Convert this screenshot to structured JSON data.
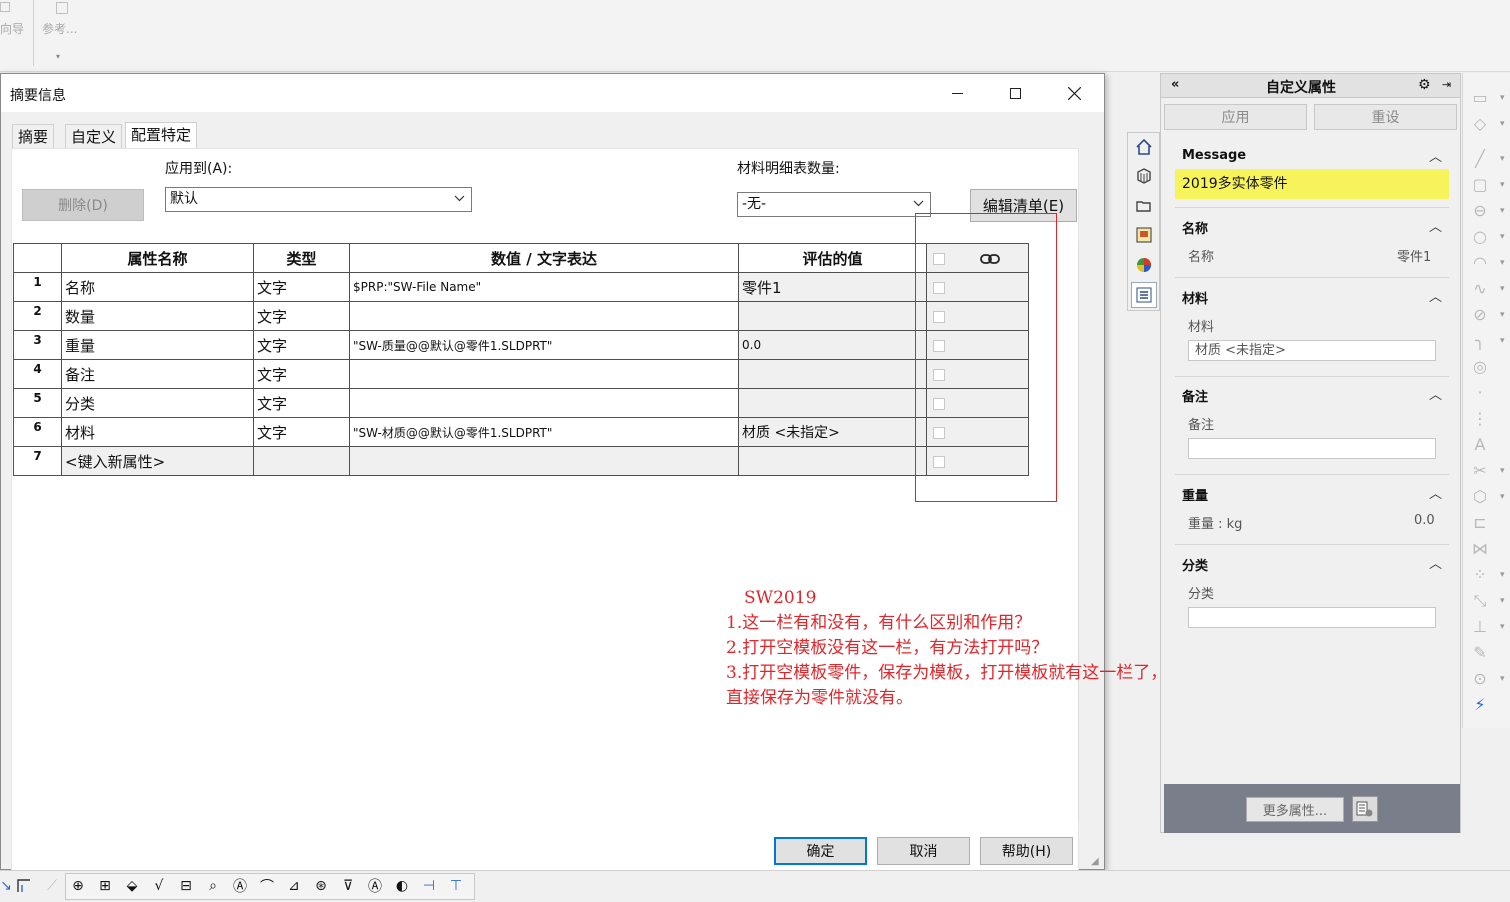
{
  "toolbar": {
    "items": [
      {
        "label": "向导"
      },
      {
        "label": "参考..."
      }
    ]
  },
  "dialog": {
    "title": "摘要信息",
    "tabs": [
      {
        "label": "摘要",
        "active": false
      },
      {
        "label": "自定义",
        "active": false
      },
      {
        "label": "配置特定",
        "active": true
      }
    ],
    "delete_label": "删除(D)",
    "apply_to_label": "应用到(A):",
    "apply_to_value": "默认",
    "bom_qty_label": "材料明细表数量:",
    "bom_qty_value": "-无-",
    "edit_list_label": "编辑清单(E)",
    "grid": {
      "headers": [
        "",
        "属性名称",
        "类型",
        "数值 / 文字表达",
        "评估的值",
        ""
      ],
      "rows": [
        {
          "num": "1",
          "name": "名称",
          "type": "文字",
          "expr": "$PRP:\"SW-File Name\"",
          "eval": "零件1"
        },
        {
          "num": "2",
          "name": "数量",
          "type": "文字",
          "expr": "",
          "eval": ""
        },
        {
          "num": "3",
          "name": "重量",
          "type": "文字",
          "expr": "\"SW-质量@@默认@零件1.SLDPRT\"",
          "eval": "0.0"
        },
        {
          "num": "4",
          "name": "备注",
          "type": "文字",
          "expr": "",
          "eval": ""
        },
        {
          "num": "5",
          "name": "分类",
          "type": "文字",
          "expr": "",
          "eval": ""
        },
        {
          "num": "6",
          "name": "材料",
          "type": "文字",
          "expr": "\"SW-材质@@默认@零件1.SLDPRT\"",
          "eval": "材质 <未指定>"
        },
        {
          "num": "7",
          "name": "<键入新属性>",
          "type": "",
          "expr": "",
          "eval": ""
        }
      ]
    },
    "ok_label": "确定",
    "cancel_label": "取消",
    "help_label": "帮助(H)"
  },
  "annotation": {
    "lines": [
      "SW2019",
      "1.这一栏有和没有，有什么区别和作用？",
      "2.打开空模板没有这一栏，有方法打开吗？",
      "3.打开空模板零件，保存为模板，打开模板就有这一栏了，",
      "直接保存为零件就没有。"
    ],
    "color": "#e0262a"
  },
  "panel": {
    "title": "自定义属性",
    "apply_label": "应用",
    "reset_label": "重设",
    "message_title": "Message",
    "message_text": "2019多实体零件",
    "message_color": "#f7f35a",
    "name_title": "名称",
    "name_label": "名称",
    "name_value": "零件1",
    "material_title": "材料",
    "material_label": "材料",
    "material_value": "材质 <未指定>",
    "remark_title": "备注",
    "remark_label": "备注",
    "weight_title": "重量",
    "weight_label": "重量 : kg",
    "weight_value": "0.0",
    "category_title": "分类",
    "category_label": "分类",
    "more_label": "更多属性..."
  }
}
